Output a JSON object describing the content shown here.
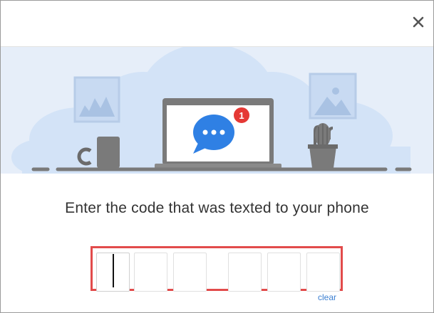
{
  "dialog": {
    "close_icon": "close-icon",
    "prompt": "Enter the code that was texted to your phone",
    "code": {
      "digits": [
        "",
        "",
        "",
        "",
        "",
        ""
      ],
      "clear_label": "clear"
    },
    "illustration": {
      "notification_count": "1",
      "colors": {
        "background": "#e6eef9",
        "cloud": "#d3e3f7",
        "bubble": "#2f80e4",
        "badge": "#e53935",
        "highlight": "#e24b4b"
      }
    }
  }
}
